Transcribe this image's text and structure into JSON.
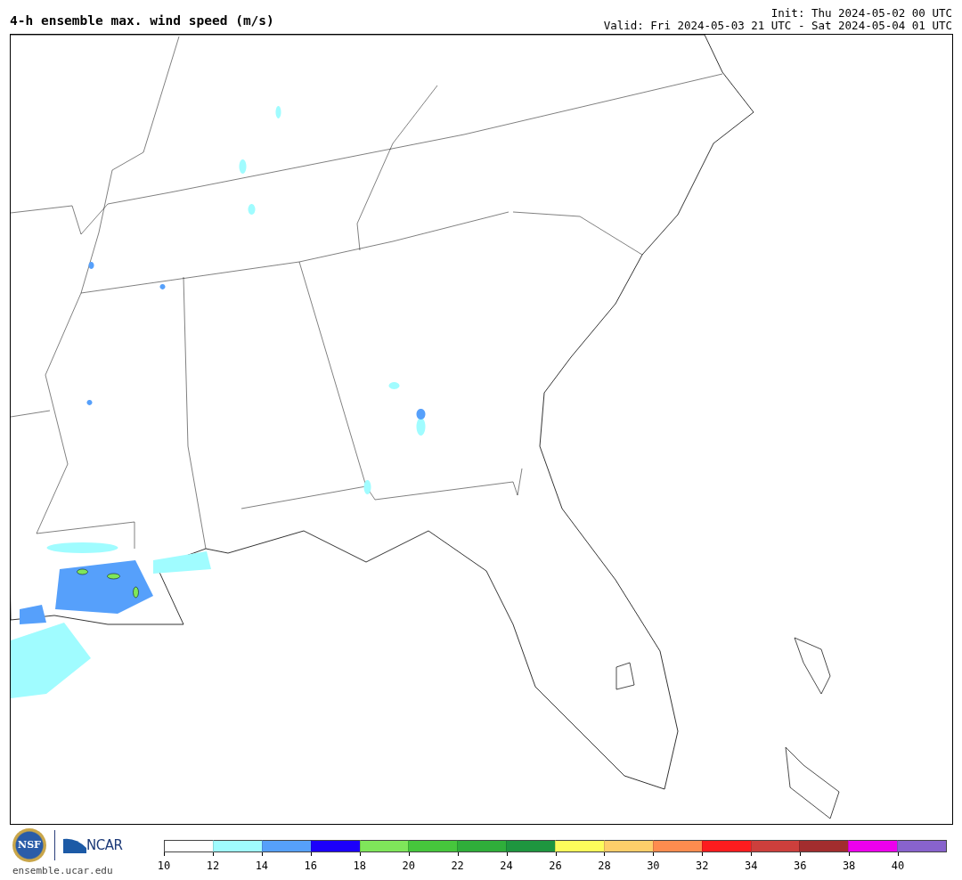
{
  "header": {
    "title": "4-h ensemble max. wind speed (m/s)",
    "init": "Init: Thu 2024-05-02 00 UTC",
    "valid": "Valid: Fri 2024-05-03 21 UTC - Sat 2024-05-04 01 UTC"
  },
  "footer": {
    "logo_left": "NSF",
    "logo_right": "NCAR",
    "site": "ensemble.ucar.edu"
  },
  "colorbar": {
    "segments": [
      {
        "color": "#ffffff"
      },
      {
        "color": "#a0fcff"
      },
      {
        "color": "#56a0fb"
      },
      {
        "color": "#1c00fb"
      },
      {
        "color": "#7fe65a"
      },
      {
        "color": "#46c63c"
      },
      {
        "color": "#2fae3a"
      },
      {
        "color": "#1e963f"
      },
      {
        "color": "#fdfd5b"
      },
      {
        "color": "#fece6a"
      },
      {
        "color": "#fe8c4f"
      },
      {
        "color": "#fd1c1e"
      },
      {
        "color": "#cd3f3c"
      },
      {
        "color": "#a22d2e"
      },
      {
        "color": "#ed00ed"
      },
      {
        "color": "#8863cd"
      }
    ],
    "ticks": [
      "10",
      "12",
      "14",
      "16",
      "18",
      "20",
      "22",
      "24",
      "26",
      "28",
      "30",
      "32",
      "34",
      "36",
      "38",
      "40"
    ]
  }
}
